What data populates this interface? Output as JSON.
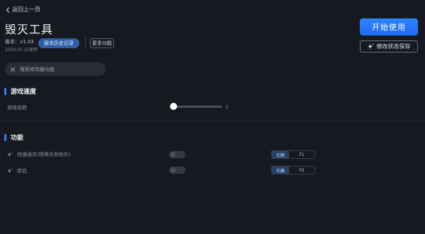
{
  "header": {
    "back_label": "返回上一页",
    "title": "毁灭工具",
    "version": "版本：v1.03",
    "updated": "2024.05.22更新",
    "history_button": "版本历史记录",
    "more_button": "更多功能"
  },
  "actions": {
    "start_label": "开始使用",
    "save_label": "修改状态保存"
  },
  "search": {
    "placeholder": "搜索修改器功能",
    "value": ""
  },
  "sections": {
    "speed_title": "游戏速度",
    "speed_label": "游戏倍数",
    "speed_value": "1",
    "speed_fraction": 0.03,
    "functions_title": "功能"
  },
  "functions": [
    {
      "label": "快速通关(特殊任务除外)",
      "enabled": false,
      "switch_label": "切换",
      "hotkey": "F1"
    },
    {
      "label": "锁血",
      "enabled": false,
      "switch_label": "切换",
      "hotkey": "F2"
    }
  ],
  "colors": {
    "background": "#161a20",
    "accent": "#2f84ff",
    "history_button": "#2f5ea8"
  }
}
